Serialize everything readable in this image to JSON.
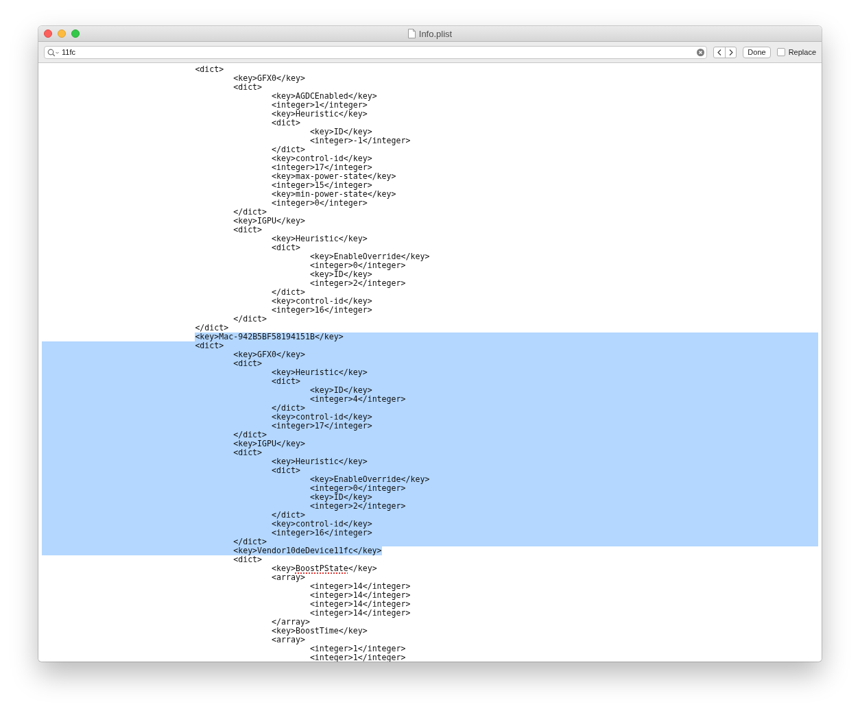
{
  "window": {
    "title": "Info.plist"
  },
  "find_bar": {
    "query": "11fc",
    "done_label": "Done",
    "replace": {
      "label": "Replace",
      "checked": false
    }
  },
  "lines": [
    {
      "text": "\t\t\t\t<dict>",
      "selected": false
    },
    {
      "text": "\t\t\t\t\t<key>GFX0</key>",
      "selected": false
    },
    {
      "text": "\t\t\t\t\t<dict>",
      "selected": false
    },
    {
      "text": "\t\t\t\t\t\t<key>AGDCEnabled</key>",
      "selected": false
    },
    {
      "text": "\t\t\t\t\t\t<integer>1</integer>",
      "selected": false
    },
    {
      "text": "\t\t\t\t\t\t<key>Heuristic</key>",
      "selected": false
    },
    {
      "text": "\t\t\t\t\t\t<dict>",
      "selected": false
    },
    {
      "text": "\t\t\t\t\t\t\t<key>ID</key>",
      "selected": false
    },
    {
      "text": "\t\t\t\t\t\t\t<integer>-1</integer>",
      "selected": false
    },
    {
      "text": "\t\t\t\t\t\t</dict>",
      "selected": false
    },
    {
      "text": "\t\t\t\t\t\t<key>control-id</key>",
      "selected": false
    },
    {
      "text": "\t\t\t\t\t\t<integer>17</integer>",
      "selected": false
    },
    {
      "text": "\t\t\t\t\t\t<key>max-power-state</key>",
      "selected": false
    },
    {
      "text": "\t\t\t\t\t\t<integer>15</integer>",
      "selected": false
    },
    {
      "text": "\t\t\t\t\t\t<key>min-power-state</key>",
      "selected": false
    },
    {
      "text": "\t\t\t\t\t\t<integer>0</integer>",
      "selected": false
    },
    {
      "text": "\t\t\t\t\t</dict>",
      "selected": false
    },
    {
      "text": "\t\t\t\t\t<key>IGPU</key>",
      "selected": false
    },
    {
      "text": "\t\t\t\t\t<dict>",
      "selected": false
    },
    {
      "text": "\t\t\t\t\t\t<key>Heuristic</key>",
      "selected": false
    },
    {
      "text": "\t\t\t\t\t\t<dict>",
      "selected": false
    },
    {
      "text": "\t\t\t\t\t\t\t<key>EnableOverride</key>",
      "selected": false
    },
    {
      "text": "\t\t\t\t\t\t\t<integer>0</integer>",
      "selected": false
    },
    {
      "text": "\t\t\t\t\t\t\t<key>ID</key>",
      "selected": false
    },
    {
      "text": "\t\t\t\t\t\t\t<integer>2</integer>",
      "selected": false
    },
    {
      "text": "\t\t\t\t\t\t</dict>",
      "selected": false
    },
    {
      "text": "\t\t\t\t\t\t<key>control-id</key>",
      "selected": false
    },
    {
      "text": "\t\t\t\t\t\t<integer>16</integer>",
      "selected": false
    },
    {
      "text": "\t\t\t\t\t</dict>",
      "selected": false
    },
    {
      "text": "\t\t\t\t</dict>",
      "selected": false
    },
    {
      "text": "\t\t\t\t<key>Mac-942B5BF58194151B</key>",
      "selected": true
    },
    {
      "text": "\t\t\t\t<dict>",
      "selected": true
    },
    {
      "text": "\t\t\t\t\t<key>GFX0</key>",
      "selected": true
    },
    {
      "text": "\t\t\t\t\t<dict>",
      "selected": true
    },
    {
      "text": "\t\t\t\t\t\t<key>Heuristic</key>",
      "selected": true
    },
    {
      "text": "\t\t\t\t\t\t<dict>",
      "selected": true
    },
    {
      "text": "\t\t\t\t\t\t\t<key>ID</key>",
      "selected": true
    },
    {
      "text": "\t\t\t\t\t\t\t<integer>4</integer>",
      "selected": true
    },
    {
      "text": "\t\t\t\t\t\t</dict>",
      "selected": true
    },
    {
      "text": "\t\t\t\t\t\t<key>control-id</key>",
      "selected": true
    },
    {
      "text": "\t\t\t\t\t\t<integer>17</integer>",
      "selected": true
    },
    {
      "text": "\t\t\t\t\t</dict>",
      "selected": true
    },
    {
      "text": "\t\t\t\t\t<key>IGPU</key>",
      "selected": true
    },
    {
      "text": "\t\t\t\t\t<dict>",
      "selected": true
    },
    {
      "text": "\t\t\t\t\t\t<key>Heuristic</key>",
      "selected": true
    },
    {
      "text": "\t\t\t\t\t\t<dict>",
      "selected": true
    },
    {
      "text": "\t\t\t\t\t\t\t<key>EnableOverride</key>",
      "selected": true
    },
    {
      "text": "\t\t\t\t\t\t\t<integer>0</integer>",
      "selected": true
    },
    {
      "text": "\t\t\t\t\t\t\t<key>ID</key>",
      "selected": true
    },
    {
      "text": "\t\t\t\t\t\t\t<integer>2</integer>",
      "selected": true
    },
    {
      "text": "\t\t\t\t\t\t</dict>",
      "selected": true
    },
    {
      "text": "\t\t\t\t\t\t<key>control-id</key>",
      "selected": true
    },
    {
      "text": "\t\t\t\t\t\t<integer>16</integer>",
      "selected": true
    },
    {
      "text": "\t\t\t\t\t</dict>",
      "selected": true
    },
    {
      "text": "\t\t\t\t\t<key>Vendor10deDevice11fc</key>",
      "selected": true
    },
    {
      "text": "\t\t\t\t\t<dict>",
      "selected": false
    },
    {
      "segments": [
        {
          "text": "\t\t\t\t\t\t<key>",
          "misspelled": false
        },
        {
          "text": "BoostPState",
          "misspelled": true
        },
        {
          "text": "</key>",
          "misspelled": false
        }
      ],
      "selected": false
    },
    {
      "text": "\t\t\t\t\t\t<array>",
      "selected": false
    },
    {
      "text": "\t\t\t\t\t\t\t<integer>14</integer>",
      "selected": false
    },
    {
      "text": "\t\t\t\t\t\t\t<integer>14</integer>",
      "selected": false
    },
    {
      "text": "\t\t\t\t\t\t\t<integer>14</integer>",
      "selected": false
    },
    {
      "text": "\t\t\t\t\t\t\t<integer>14</integer>",
      "selected": false
    },
    {
      "text": "\t\t\t\t\t\t</array>",
      "selected": false
    },
    {
      "text": "\t\t\t\t\t\t<key>BoostTime</key>",
      "selected": false
    },
    {
      "text": "\t\t\t\t\t\t<array>",
      "selected": false
    },
    {
      "text": "\t\t\t\t\t\t\t<integer>1</integer>",
      "selected": false
    },
    {
      "text": "\t\t\t\t\t\t\t<integer>1</integer>",
      "selected": false
    }
  ]
}
